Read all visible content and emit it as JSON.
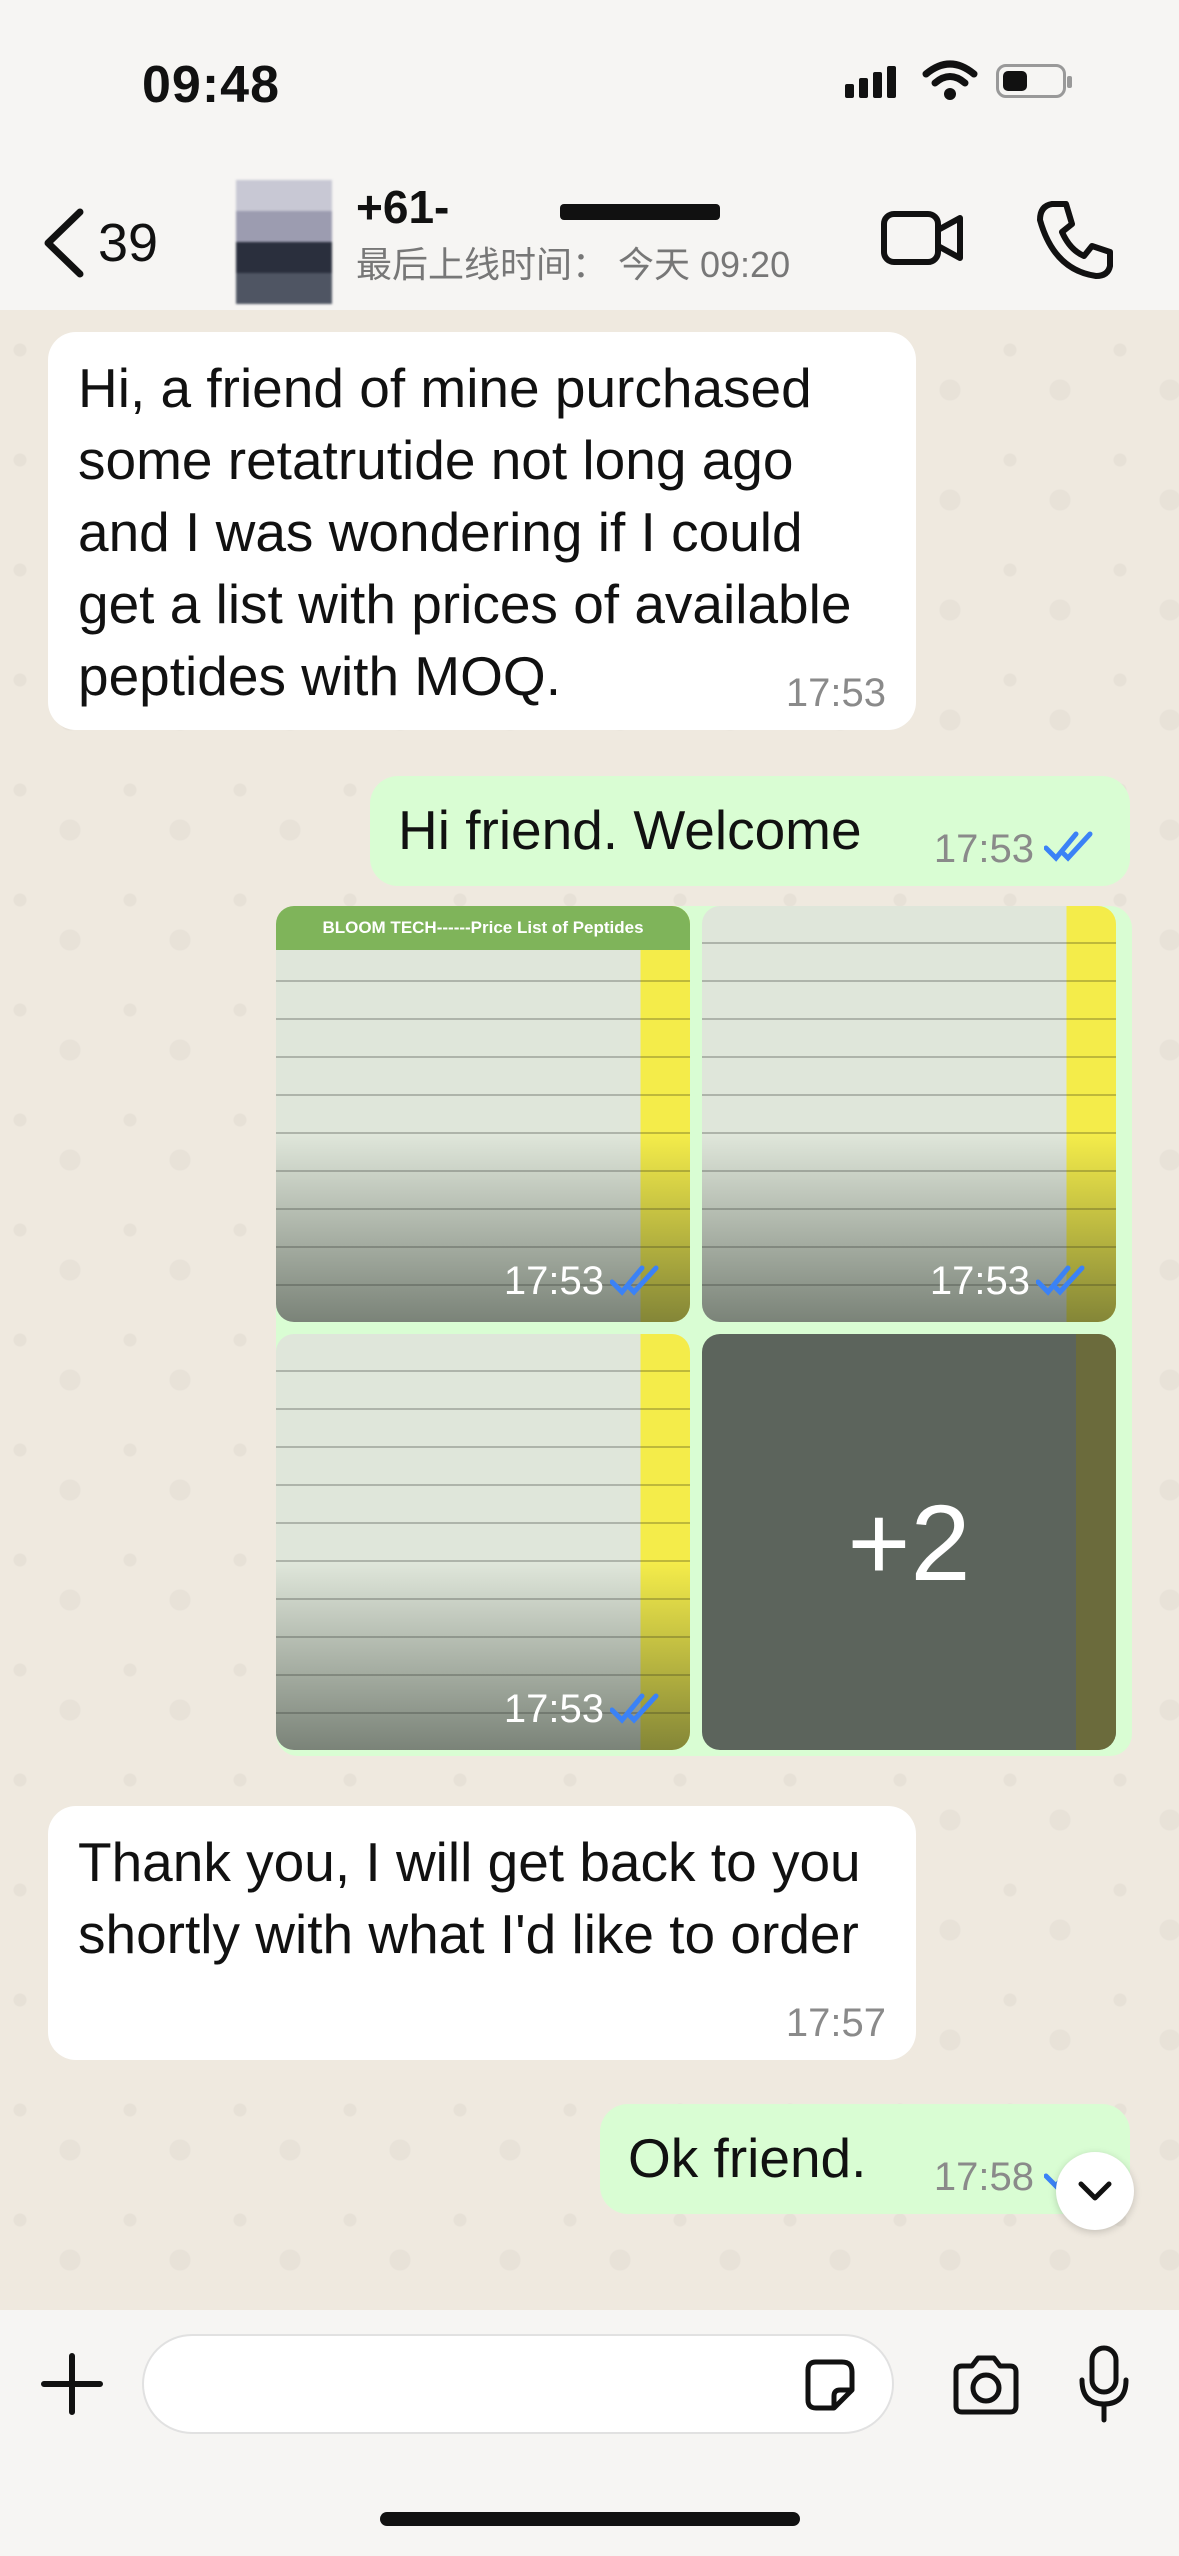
{
  "status": {
    "time": "09:48"
  },
  "header": {
    "back_count": "39",
    "contact_name": "+61-",
    "contact_status": "最后上线时间： 今天 09:20"
  },
  "messages": [
    {
      "direction": "incoming",
      "text": "Hi, a friend of mine purchased some retatrutide not long ago and I was wondering if I could get a list with prices of available peptides with MOQ.",
      "time": "17:53"
    },
    {
      "direction": "outgoing",
      "text": "Hi friend. Welcome",
      "time": "17:53",
      "read": true
    },
    {
      "direction": "incoming",
      "text": "Thank you, I will get back to you shortly with what I'd like to order",
      "time": "17:57"
    },
    {
      "direction": "outgoing",
      "text": "Ok friend.",
      "time": "17:58",
      "read": true
    }
  ],
  "image_grid": {
    "tiles": [
      {
        "caption": "BLOOM TECH------Price List of Peptides",
        "time": "17:53",
        "read": true
      },
      {
        "caption": "",
        "time": "17:53",
        "read": true
      },
      {
        "caption": "",
        "time": "17:53",
        "read": true
      },
      {
        "caption": "",
        "time": "",
        "read": false
      }
    ],
    "more_count": "+2"
  },
  "icons": {
    "back": "chevron-left-icon",
    "video": "video-camera-icon",
    "call": "phone-icon",
    "scroll": "chevron-down-icon",
    "attach": "plus-icon",
    "sticker": "sticker-icon",
    "camera": "camera-icon",
    "mic": "microphone-icon"
  },
  "colors": {
    "incoming_bubble": "#ffffff",
    "outgoing_bubble": "#d9fdd3",
    "read_tick": "#3b82f6",
    "wallpaper": "#efe9df"
  }
}
